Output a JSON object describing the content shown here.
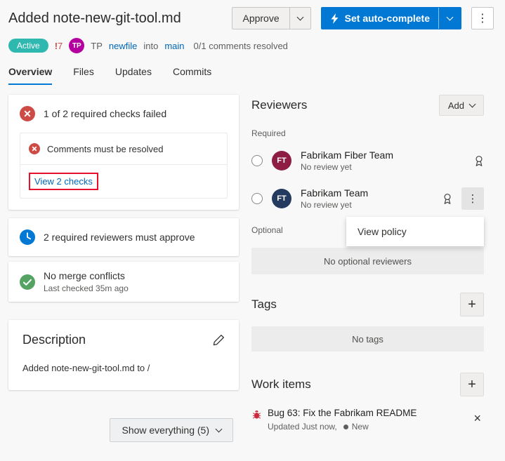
{
  "page": {
    "title": "Added note-new-git-tool.md"
  },
  "header": {
    "approve": "Approve",
    "auto_complete": "Set auto-complete"
  },
  "meta": {
    "status": "Active",
    "conflict_marker": "!",
    "conflict_count": "7",
    "author_initials": "TP",
    "author_name": "TP",
    "source_branch": "newfile",
    "into": "into",
    "target_branch": "main",
    "comments": "0/1 comments resolved"
  },
  "tabs": {
    "overview": "Overview",
    "files": "Files",
    "updates": "Updates",
    "commits": "Commits"
  },
  "checks": {
    "summary": "1 of 2 required checks failed",
    "comment_check": "Comments must be resolved",
    "view_link": "View 2 checks",
    "reviewers_required": "2 required reviewers must approve",
    "merge_title": "No merge conflicts",
    "merge_subtitle": "Last checked 35m ago"
  },
  "description": {
    "title": "Description",
    "body": "Added note-new-git-tool.md to /"
  },
  "footer": {
    "show_everything": "Show everything (5)"
  },
  "reviewers": {
    "title": "Reviewers",
    "add": "Add",
    "required": "Required",
    "optional": "Optional",
    "no_optional": "No optional reviewers",
    "menu_view_policy": "View policy",
    "items": [
      {
        "initials": "FT",
        "name": "Fabrikam Fiber Team",
        "status": "No review yet",
        "color": "#8e1c43"
      },
      {
        "initials": "FT",
        "name": "Fabrikam Team",
        "status": "No review yet",
        "color": "#243a5e"
      }
    ]
  },
  "tags": {
    "title": "Tags",
    "empty": "No tags"
  },
  "work_items": {
    "title": "Work items",
    "item_title": "Bug 63: Fix the Fabrikam README",
    "item_updated": "Updated Just now,",
    "item_state": "New"
  },
  "icons": {
    "more": "⋮",
    "close": "×",
    "add": "+"
  },
  "colors": {
    "accent": "#0078d4",
    "error": "#cd4a45",
    "success": "#55a362",
    "active_badge": "#2eb8b0",
    "author_avatar": "#b4009e",
    "annotation": "#e8112d",
    "bug": "#cc293d"
  }
}
